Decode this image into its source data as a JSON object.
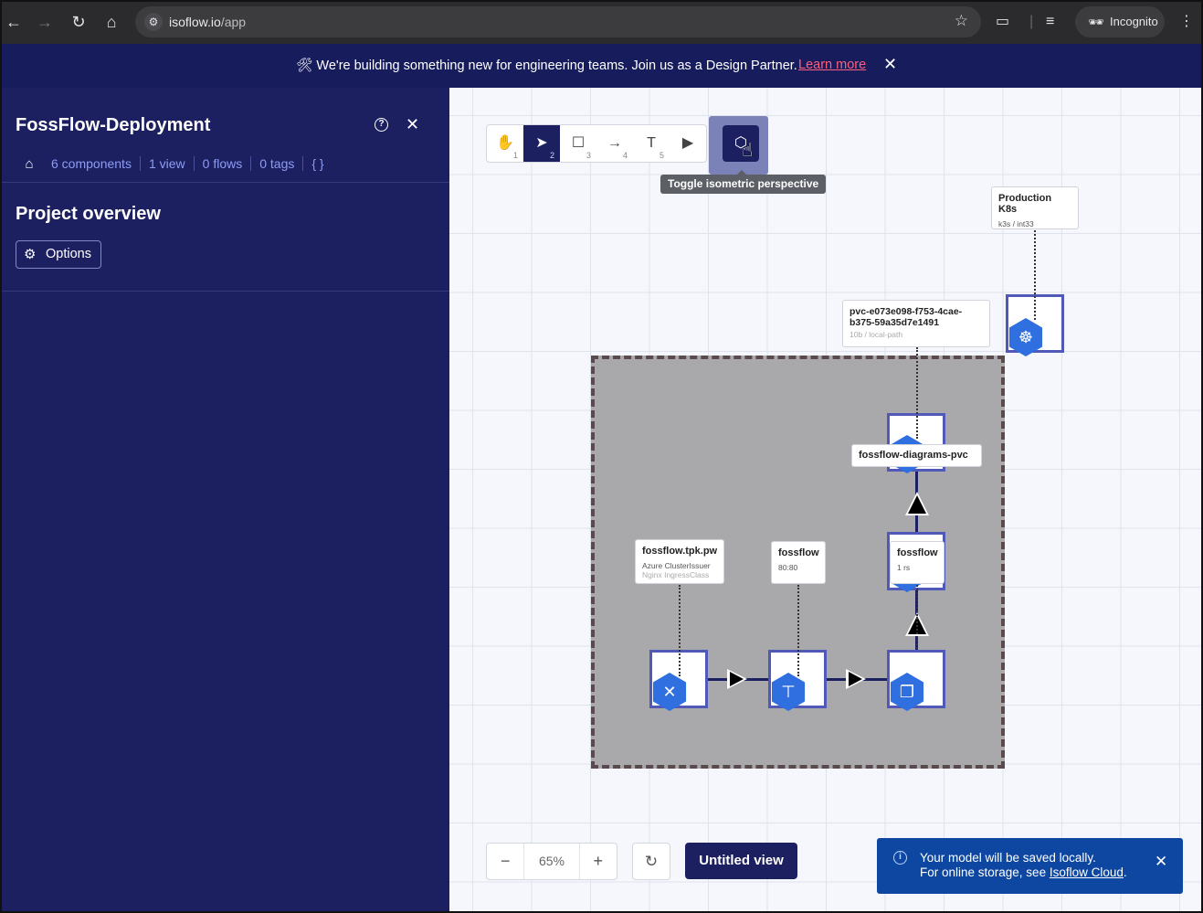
{
  "browser": {
    "url_host": "isoflow.io",
    "url_path": "/app",
    "profile_label": "Incognito"
  },
  "banner": {
    "message": "🛠 We're building something new for engineering teams. Join us as a Design Partner.",
    "link_label": "Learn more",
    "close_icon": "✕"
  },
  "sidebar": {
    "title": "FossFlow-Deployment",
    "meta": {
      "components": "6 components",
      "views": "1 view",
      "flows": "0 flows",
      "tags": "0 tags",
      "json": "{ }"
    },
    "section_title": "Project overview",
    "options_label": "Options"
  },
  "toolbar": {
    "tools": [
      {
        "name": "pan-tool",
        "icon": "✋",
        "key": "1"
      },
      {
        "name": "select-tool",
        "icon": "➤",
        "key": "2"
      },
      {
        "name": "rectangle-tool",
        "icon": "☐",
        "key": "3"
      },
      {
        "name": "connector-tool",
        "icon": "→",
        "key": "4"
      },
      {
        "name": "text-tool",
        "icon": "T",
        "key": "5"
      },
      {
        "name": "slide-tool",
        "icon": "▶",
        "key": ""
      }
    ],
    "iso_tooltip": "Toggle isometric perspective"
  },
  "diagram": {
    "labels": {
      "production": {
        "title": "Production K8s",
        "sub": "k3s / int33"
      },
      "pvc": {
        "title": "pvc-e073e098-f753-4cae-b375-59a35d7e1491",
        "sub": "10b / local-path"
      },
      "pvc_name": {
        "title": "fossflow-diagrams-pvc"
      },
      "ingress": {
        "title": "fossflow.tpk.pw",
        "sub": "Azure ClusterIssuer",
        "sub2": "Nginx IngressClass"
      },
      "service": {
        "title": "fossflow",
        "sub": "80:80"
      },
      "deployment": {
        "title": "fossflow",
        "sub": "1 rs"
      }
    }
  },
  "controls": {
    "zoom_value": "65%",
    "zoom_out": "−",
    "zoom_in": "+",
    "reset_icon": "↻",
    "view_label": "Untitled view"
  },
  "toast": {
    "line1": "Your model will be saved locally.",
    "line2_prefix": "For online storage, see ",
    "line2_link": "Isoflow Cloud",
    "line2_suffix": "."
  }
}
